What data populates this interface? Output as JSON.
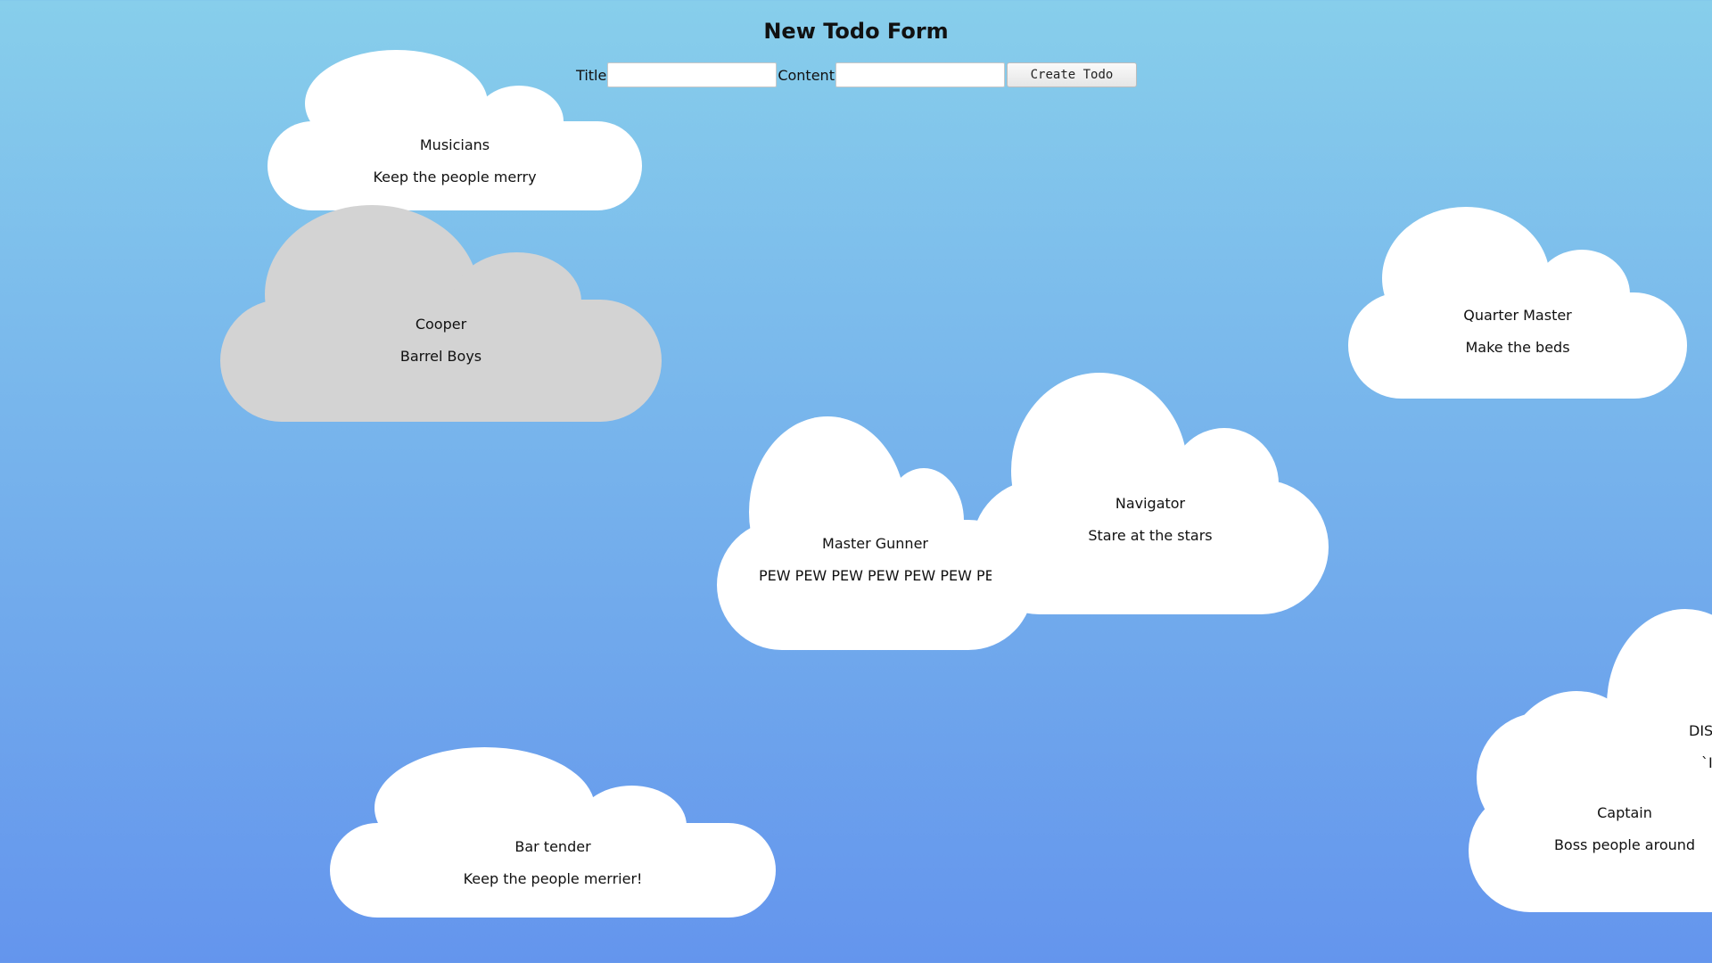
{
  "form": {
    "heading": "New Todo Form",
    "title_label": "Title",
    "title_value": "",
    "content_label": "Content",
    "content_value": "",
    "submit_label": "Create Todo"
  },
  "colors": {
    "sky_top": "#87ceeb",
    "sky_bottom": "#6495ed",
    "cloud": "#ffffff",
    "cloud_selected": "#d3d3d3"
  },
  "todos": [
    {
      "title": "Musicians",
      "content": "Keep the people merry"
    },
    {
      "title": "Cooper",
      "content": "Barrel Boys",
      "selected": true
    },
    {
      "title": "Quarter Master",
      "content": "Make the beds"
    },
    {
      "title": "Navigator",
      "content": "Stare at the stars"
    },
    {
      "title": "Master Gunner",
      "content": "PEW PEW PEW PEW PEW PEW PEW"
    },
    {
      "title": "DIS",
      "content": "`I"
    },
    {
      "title": "Captain",
      "content": "Boss people around"
    },
    {
      "title": "Bar tender",
      "content": "Keep the people merrier!"
    }
  ]
}
